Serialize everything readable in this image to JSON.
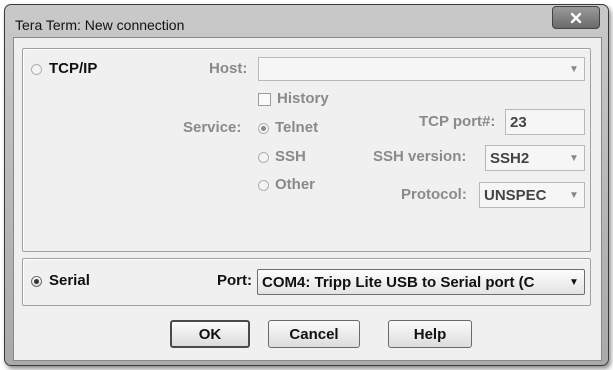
{
  "window": {
    "title": "Tera Term: New connection"
  },
  "tcpip": {
    "radio_label": "TCP/IP",
    "host": {
      "label": "Host:",
      "value": ""
    },
    "history": {
      "label": "History",
      "checked": false
    },
    "service": {
      "label": "Service:",
      "options": [
        "Telnet",
        "SSH",
        "Other"
      ],
      "selected": "Telnet"
    },
    "tcp_port": {
      "label": "TCP port#:",
      "value": "23"
    },
    "ssh_version": {
      "label": "SSH version:",
      "value": "SSH2"
    },
    "protocol": {
      "label": "Protocol:",
      "value": "UNSPEC"
    }
  },
  "serial": {
    "radio_label": "Serial",
    "selected": true,
    "port": {
      "label": "Port:",
      "value": "COM4: Tripp Lite USB to Serial port (C"
    }
  },
  "buttons": {
    "ok": "OK",
    "cancel": "Cancel",
    "help": "Help"
  },
  "icons": {
    "close": "close-icon",
    "dropdown": "chevron-down-icon"
  }
}
